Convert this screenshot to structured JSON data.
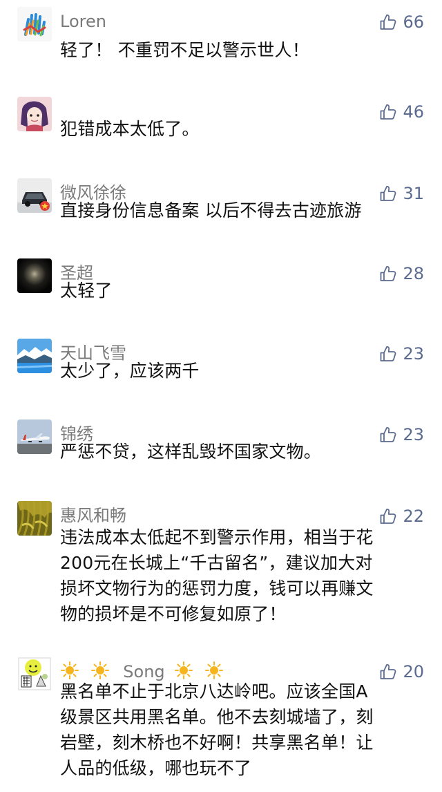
{
  "comments": [
    {
      "nickname": "Loren",
      "likes": "66",
      "text": "轻了！ 不重罚不足以警示世人！",
      "avatar_icon": "colorful-hand-icon"
    },
    {
      "nickname": "",
      "likes": "46",
      "text": "犯错成本太低了。",
      "avatar_icon": "anime-girl-icon"
    },
    {
      "nickname": "微风徐徐",
      "likes": "31",
      "text": "直接身份信息备案 以后不得去古迹旅游",
      "avatar_icon": "car-icon"
    },
    {
      "nickname": "圣超",
      "likes": "28",
      "text": "太轻了",
      "avatar_icon": "dark-glow-icon"
    },
    {
      "nickname": "天山飞雪",
      "likes": "23",
      "text": "太少了，应该两千",
      "avatar_icon": "lake-landscape-icon"
    },
    {
      "nickname": "锦绣",
      "likes": "23",
      "text": "严惩不贷，这样乱毁坏国家文物。",
      "avatar_icon": "airplane-icon"
    },
    {
      "nickname": "惠风和畅",
      "likes": "22",
      "text_lines": [
        "违法成本太低起不到警示作用，相当于花",
        "200元在长城上“千古留名”，建议加大对",
        "损坏文物行为的惩罚力度，钱可以再赚文",
        "物的损坏是不可修复如原了！"
      ],
      "avatar_icon": "rice-field-icon"
    },
    {
      "nickname": "Song",
      "likes": "20",
      "text_lines": [
        "黑名单不止于北京八达岭吧。应该全国A",
        "级景区共用黑名单。他不去刻城墙了，刻",
        "岩壁，刻木桥也不好啊！共享黑名单！让",
        "人品的低级，哪也玩不了"
      ],
      "avatar_icon": "cartoon-collage-icon",
      "name_decoration_icon": "sun-icon"
    }
  ],
  "colors": {
    "nickname": "#7a7a7a",
    "like": "#5b6b8f",
    "text": "#111111"
  }
}
